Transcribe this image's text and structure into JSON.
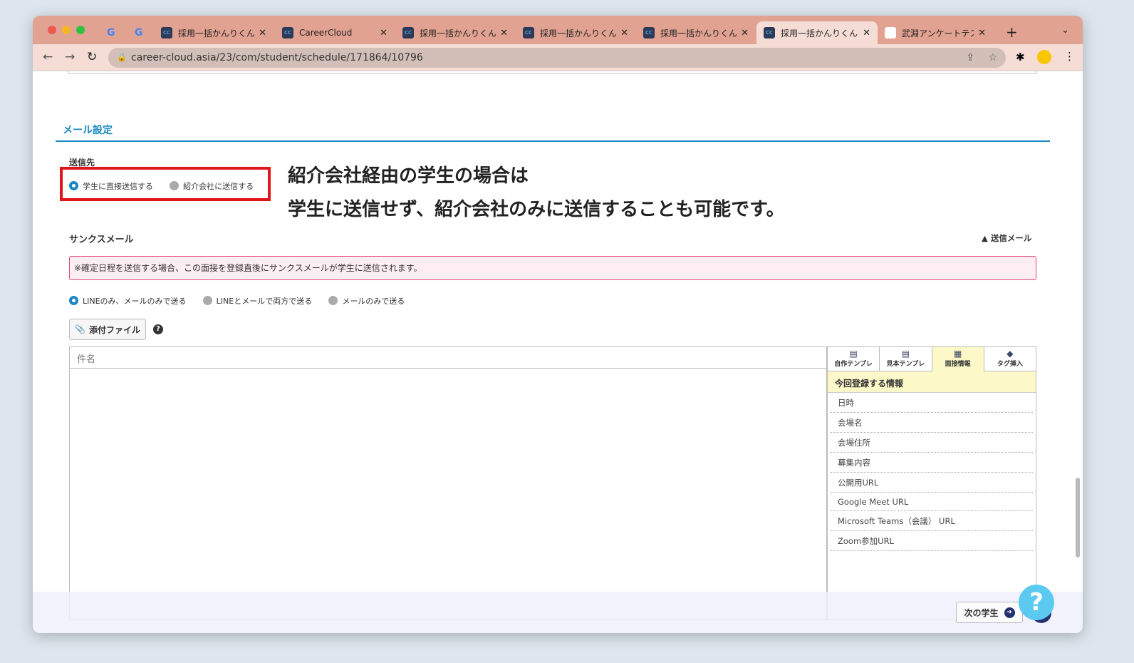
{
  "browser": {
    "tabs": [
      {
        "label": "採用一括かんりくん"
      },
      {
        "label": "CareerCloud"
      },
      {
        "label": "採用一括かんりくん"
      },
      {
        "label": "採用一括かんりくん"
      },
      {
        "label": "採用一括かんりくん"
      },
      {
        "label": "採用一括かんりくん",
        "active": true
      },
      {
        "label": "武淵アンケートテスト"
      }
    ],
    "url": "career-cloud.asia/23/com/student/schedule/171864/10796"
  },
  "mail_settings": {
    "title": "メール設定",
    "recipient_label": "送信先",
    "recipient_options": [
      "学生に直接送信する",
      "紹介会社に送信する"
    ],
    "annotation_line1": "紹介会社経由の学生の場合は",
    "annotation_line2": "学生に送信せず、紹介会社のみに送信することも可能です。",
    "thanks_label": "サンクスメール",
    "sent_mail_toggle": "送信メール",
    "notice": "※確定日程を送信する場合、この面接を登録直後にサンクスメールが学生に送信されます。",
    "send_options": [
      "LINEのみ、メールのみで送る",
      "LINEとメールで両方で送る",
      "メールのみで送る"
    ],
    "attach_label": "添付ファイル",
    "subject_placeholder": "件名"
  },
  "side_panel": {
    "tabs": [
      "自作テンプレ",
      "見本テンプレ",
      "面接情報",
      "タグ挿入"
    ],
    "header": "今回登録する情報",
    "items": [
      "日時",
      "会場名",
      "会場住所",
      "募集内容",
      "公開用URL",
      "Google Meet URL",
      "Microsoft Teams（会議） URL",
      "Zoom参加URL"
    ]
  },
  "footer": {
    "next_student": "次の学生"
  }
}
